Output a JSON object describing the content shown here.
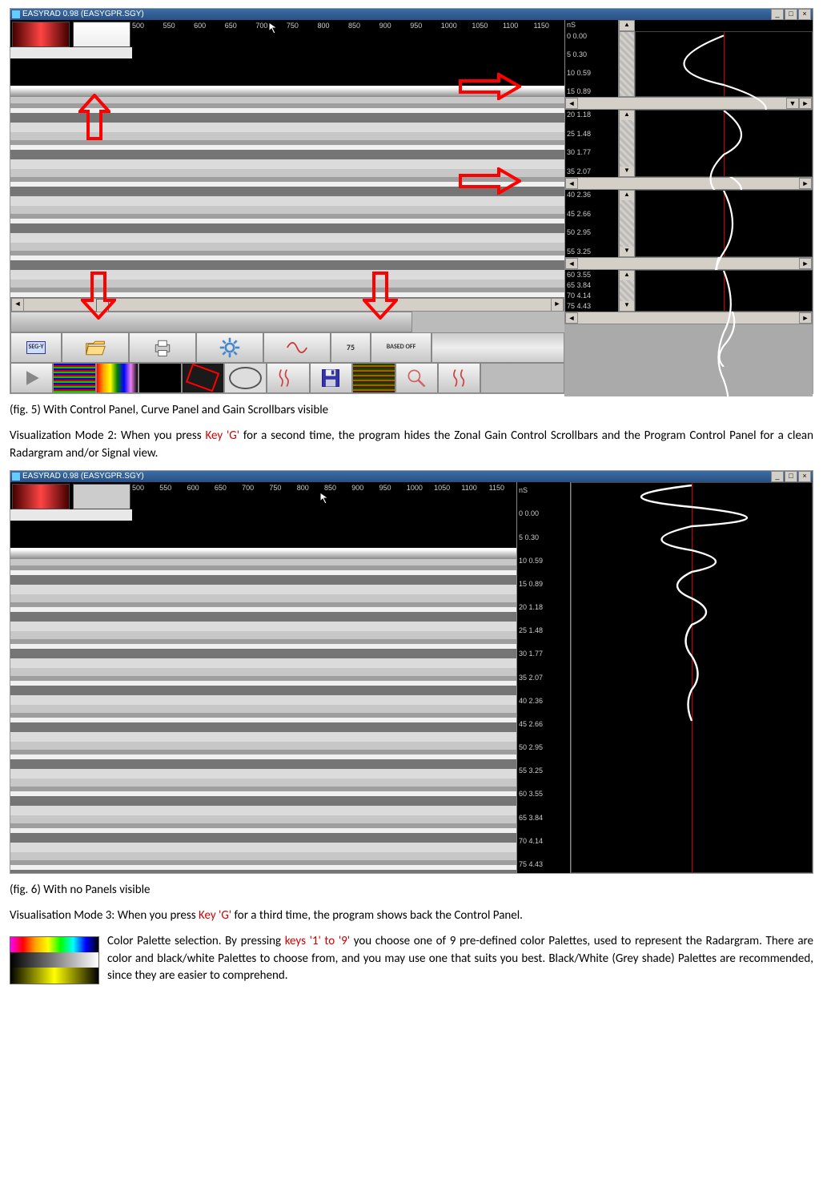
{
  "window_title": "EASYRAD 0.98 (EASYGPR.SGY)",
  "winbtns": {
    "min": "_",
    "max": "□",
    "close": "×"
  },
  "x_ticks": [
    "500",
    "550",
    "600",
    "650",
    "700",
    "750",
    "800",
    "850",
    "900",
    "950",
    "1000",
    "1050",
    "1100",
    "1150"
  ],
  "y_unit": "nS",
  "y_ticks": [
    "0 0.00",
    "5 0.30",
    "10 0.59",
    "15 0.89",
    "20 1.18",
    "25 1.48",
    "30 1.77",
    "35 2.07",
    "40 2.36",
    "45 2.66",
    "50 2.95",
    "55 3.25",
    "60 3.55",
    "65 3.84",
    "70 4.14",
    "75 4.43"
  ],
  "toolbar": {
    "depth_value": "75",
    "based_label": "BASED OFF",
    "segy_label": "SEG-Y"
  },
  "captions": {
    "fig5": "(fig. 5) With Control Panel, Curve Panel and Gain Scrollbars visible",
    "fig6": "(fig. 6) With no Panels visible"
  },
  "para": {
    "p1a": "Visualization Mode 2: When you press ",
    "p1key": "Key 'G'",
    "p1b": " for a second time, the program hides the Zonal Gain Control Scrollbars and the Program Control Panel for a clean Radargram and/or Signal view.",
    "p2a": "Visualisation Mode 3: When you press ",
    "p2key": "Key 'G'",
    "p2b": " for a third time, the program shows back the Control Panel.",
    "p3a": "Color Palette selection. By pressing ",
    "p3key": "keys '1' to '9'",
    "p3b": " you choose one of 9 pre-defined color Palettes, used to represent the Radargram. There are color and black/white Palettes to choose from, and you may use one that suits you best. Black/White (Grey shade) Palettes are recommended, since they are easier to comprehend."
  }
}
